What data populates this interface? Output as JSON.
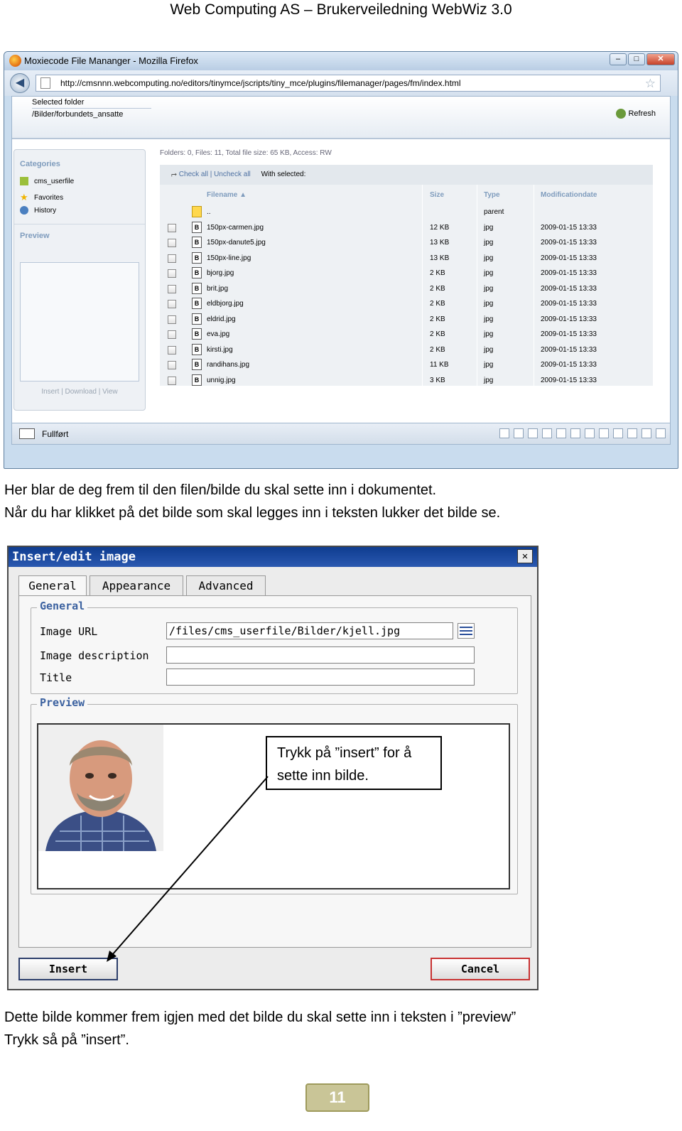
{
  "document": {
    "header": "Web Computing AS – Brukerveiledning WebWiz 3.0",
    "para1_line1": "Her blar de deg frem til den filen/bilde du skal sette inn i dokumentet.",
    "para1_line2": "Når du har klikket på det bilde som skal legges inn i teksten lukker det bilde se.",
    "para2_line1": "Dette bilde kommer frem igjen med det bilde du skal sette inn i teksten i ”preview”",
    "para2_line2": "Trykk så på ”insert”.",
    "page_number": "11"
  },
  "browser": {
    "title": "Moxiecode File Mananger - Mozilla Firefox",
    "url": "http://cmsnnn.webcomputing.no/editors/tinymce/jscripts/tiny_mce/plugins/filemanager/pages/fm/index.html",
    "status": "Fullført"
  },
  "file_manager": {
    "selected_folder_label": "Selected folder",
    "selected_folder_value": "/Bilder/forbundets_ansatte",
    "refresh_label": "Refresh",
    "categories_heading": "Categories",
    "categories": [
      "cms_userfile",
      "Favorites",
      "History"
    ],
    "preview_heading": "Preview",
    "side_links": "Insert | Download | View",
    "info": "Folders: 0, Files: 11, Total file size: 65 KB, Access: RW",
    "check_all": "Check all",
    "uncheck_all": "Uncheck all",
    "with_selected": "With selected:",
    "columns": [
      "Filename",
      "Size",
      "Type",
      "Modificationdate"
    ],
    "parent_row": {
      "name": "..",
      "type": "parent"
    },
    "files": [
      {
        "name": "150px-carmen.jpg",
        "size": "12 KB",
        "type": "jpg",
        "date": "2009-01-15 13:33"
      },
      {
        "name": "150px-danute5.jpg",
        "size": "13 KB",
        "type": "jpg",
        "date": "2009-01-15 13:33"
      },
      {
        "name": "150px-line.jpg",
        "size": "13 KB",
        "type": "jpg",
        "date": "2009-01-15 13:33"
      },
      {
        "name": "bjorg.jpg",
        "size": "2 KB",
        "type": "jpg",
        "date": "2009-01-15 13:33"
      },
      {
        "name": "brit.jpg",
        "size": "2 KB",
        "type": "jpg",
        "date": "2009-01-15 13:33"
      },
      {
        "name": "eldbjorg.jpg",
        "size": "2 KB",
        "type": "jpg",
        "date": "2009-01-15 13:33"
      },
      {
        "name": "eldrid.jpg",
        "size": "2 KB",
        "type": "jpg",
        "date": "2009-01-15 13:33"
      },
      {
        "name": "eva.jpg",
        "size": "2 KB",
        "type": "jpg",
        "date": "2009-01-15 13:33"
      },
      {
        "name": "kirsti.jpg",
        "size": "2 KB",
        "type": "jpg",
        "date": "2009-01-15 13:33"
      },
      {
        "name": "randihans.jpg",
        "size": "11 KB",
        "type": "jpg",
        "date": "2009-01-15 13:33"
      },
      {
        "name": "unnig.jpg",
        "size": "3 KB",
        "type": "jpg",
        "date": "2009-01-15 13:33"
      }
    ]
  },
  "dialog": {
    "title": "Insert/edit image",
    "tabs": [
      "General",
      "Appearance",
      "Advanced"
    ],
    "general_legend": "General",
    "image_url_label": "Image URL",
    "image_url_value": "/files/cms_userfile/Bilder/kjell.jpg",
    "image_description_label": "Image description",
    "image_description_value": "",
    "title_label": "Title",
    "title_value": "",
    "preview_legend": "Preview",
    "callout_line1": "Trykk på ”insert” for å",
    "callout_line2": "sette inn bilde.",
    "insert_button": "Insert",
    "cancel_button": "Cancel"
  }
}
